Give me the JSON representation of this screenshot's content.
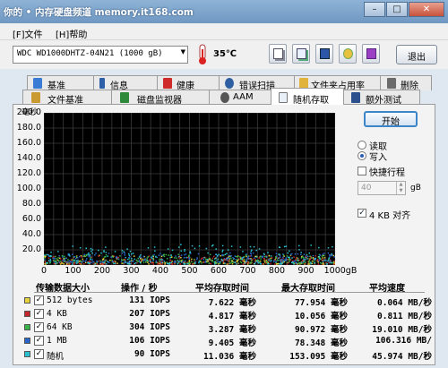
{
  "window": {
    "title": "你的 • 内存硬盘频道 memory.it168.com",
    "minimize": "–",
    "maximize": "□",
    "close": "✕"
  },
  "menu": [
    {
      "label": "[F]文件"
    },
    {
      "label": "[H]帮助"
    }
  ],
  "toolbar": {
    "drive": "WDC WD1000DHTZ-04N21  (1000 gB)",
    "temperature": "35℃",
    "exit_label": "退出",
    "icons": [
      "copy-icon",
      "copy-screen-icon",
      "save-icon",
      "options-icon",
      "download-icon"
    ]
  },
  "tabs_row1": [
    {
      "label": "基准",
      "icon": "benchmark-icon"
    },
    {
      "label": "信息",
      "icon": "info-icon"
    },
    {
      "label": "健康",
      "icon": "health-icon"
    },
    {
      "label": "错误扫描",
      "icon": "error-scan-icon"
    },
    {
      "label": "文件夹占用率",
      "icon": "folder-usage-icon"
    },
    {
      "label": "删除",
      "icon": "erase-icon"
    }
  ],
  "tabs_row2": [
    {
      "label": "文件基准",
      "icon": "file-benchmark-icon"
    },
    {
      "label": "磁盘监视器",
      "icon": "disk-monitor-icon"
    },
    {
      "label": "AAM",
      "icon": "aam-icon"
    },
    {
      "label": "随机存取",
      "icon": "random-access-icon",
      "active": true
    },
    {
      "label": "额外测试",
      "icon": "extra-tests-icon"
    }
  ],
  "chart_data": {
    "type": "scatter",
    "ylabel": "毫秒",
    "xlabel": "",
    "xlim": [
      0,
      1000
    ],
    "ylim": [
      0,
      200
    ],
    "yticks": [
      "200.0",
      "180.0",
      "160.0",
      "140.0",
      "120.0",
      "100.0",
      "80.0",
      "60.0",
      "40.0",
      "20.0"
    ],
    "xticks": [
      "0",
      "100",
      "200",
      "300",
      "400",
      "500",
      "600",
      "700",
      "800",
      "900",
      "1000gB"
    ],
    "grid": true,
    "series": [
      {
        "name": "512 bytes",
        "color": "#e8d23a",
        "y_range": [
          2,
          14
        ]
      },
      {
        "name": "4 KB",
        "color": "#c8262c",
        "y_range": [
          2,
          13
        ]
      },
      {
        "name": "64 KB",
        "color": "#39b54a",
        "y_range": [
          3,
          15
        ]
      },
      {
        "name": "1 MB",
        "color": "#2a66c9",
        "y_range": [
          4,
          17
        ]
      },
      {
        "name": "随机",
        "color": "#2bc0d0",
        "y_range": [
          2,
          28
        ]
      }
    ]
  },
  "controls": {
    "start_label": "开始",
    "read_label": "读取",
    "write_label": "写入",
    "selected": "write",
    "short_stroke_label": "快捷行程",
    "short_stroke_checked": false,
    "short_stroke_value": "40",
    "short_stroke_unit": "gB",
    "align_label": "4 KB 对齐",
    "align_checked": true
  },
  "table": {
    "headers": [
      "传输数据大小",
      "操作 / 秒",
      "平均存取时间",
      "最大存取时间",
      "平均速度"
    ],
    "rows": [
      {
        "label": "512 bytes",
        "color": "#e8d23a",
        "ops": "131 IOPS",
        "avg": "7.622 毫秒",
        "max": "77.954 毫秒",
        "speed": "0.064 MB/秒"
      },
      {
        "label": "4 KB",
        "color": "#c8262c",
        "ops": "207 IOPS",
        "avg": "4.817 毫秒",
        "max": "10.056 毫秒",
        "speed": "0.811 MB/秒"
      },
      {
        "label": "64 KB",
        "color": "#39b54a",
        "ops": "304 IOPS",
        "avg": "3.287 毫秒",
        "max": "90.972 毫秒",
        "speed": "19.010 MB/秒"
      },
      {
        "label": "1 MB",
        "color": "#2a66c9",
        "ops": "106 IOPS",
        "avg": "9.405 毫秒",
        "max": "78.348 毫秒",
        "speed": "106.316 MB/"
      },
      {
        "label": "随机",
        "color": "#2bc0d0",
        "ops": "90 IOPS",
        "avg": "11.036 毫秒",
        "max": "153.095 毫秒",
        "speed": "45.974 MB/秒"
      }
    ]
  }
}
